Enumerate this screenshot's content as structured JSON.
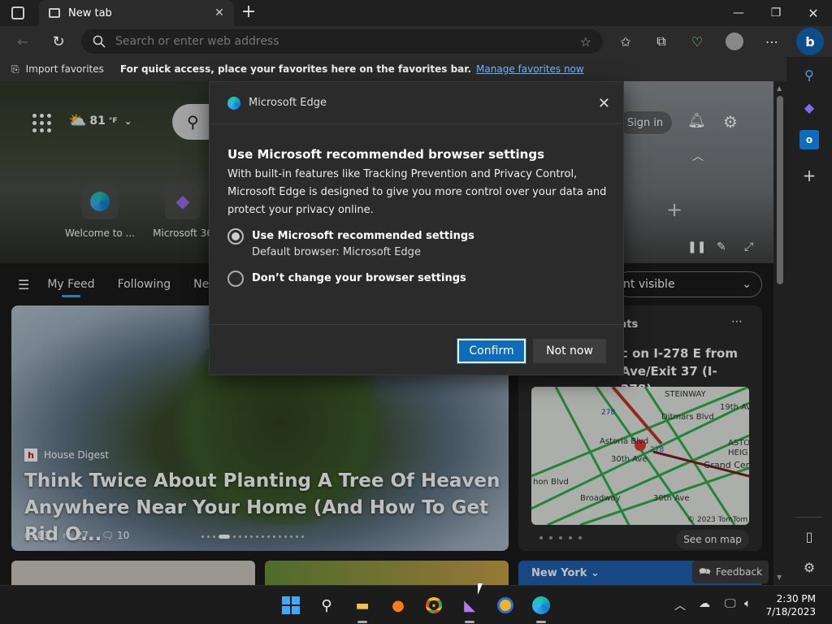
{
  "tab": {
    "title": "New tab"
  },
  "address": {
    "placeholder": "Search or enter web address"
  },
  "favorites_bar": {
    "import_label": "Import favorites",
    "hint": "For quick access, place your favorites here on the favorites bar.",
    "manage_link": "Manage favorites now"
  },
  "hero": {
    "weather": "81",
    "weather_unit": "°F",
    "sign_in": "Sign in",
    "quick_links": [
      {
        "label": "Welcome to ..."
      },
      {
        "label": "Microsoft 36"
      }
    ]
  },
  "feed_nav": {
    "items": [
      "My Feed",
      "Following",
      "News"
    ],
    "visible_dropdown": "nt visible"
  },
  "main_card": {
    "source": "House Digest",
    "headline": "Think Twice About Planting A Tree Of Heaven Anywhere Near Your Home (And How To Get Rid O...",
    "likes": "83",
    "dislikes": "27",
    "comments": "10"
  },
  "traffic_card": {
    "title": "nts",
    "text": "c on I-278 E from Ave/Exit 37 (I-278)...",
    "see_map": "See on map",
    "map_labels": [
      "STEINWAY",
      "19th Ave",
      "Ditmars Blvd",
      "Astoria Blvd",
      "30th Ave",
      "Grand Cen",
      "Broadway",
      "30th Ave",
      "hon Blvd",
      "ASTO",
      "HEIG",
      "278",
      "278"
    ],
    "map_credit": "© 2023 TomTom"
  },
  "bottom": {
    "city": "New York",
    "feedback": "Feedback"
  },
  "dialog": {
    "header": "Microsoft Edge",
    "title": "Use Microsoft recommended browser settings",
    "body": "With built-in features like Tracking Prevention and Privacy Control, Microsoft Edge is designed to give you more control over your data and protect your privacy online.",
    "option1_label": "Use Microsoft recommended settings",
    "option1_sub": "Default browser: Microsoft Edge",
    "option2_label": "Don’t change your browser settings",
    "confirm": "Confirm",
    "not_now": "Not now"
  },
  "taskbar": {
    "time": "2:30 PM",
    "date": "7/18/2023"
  }
}
